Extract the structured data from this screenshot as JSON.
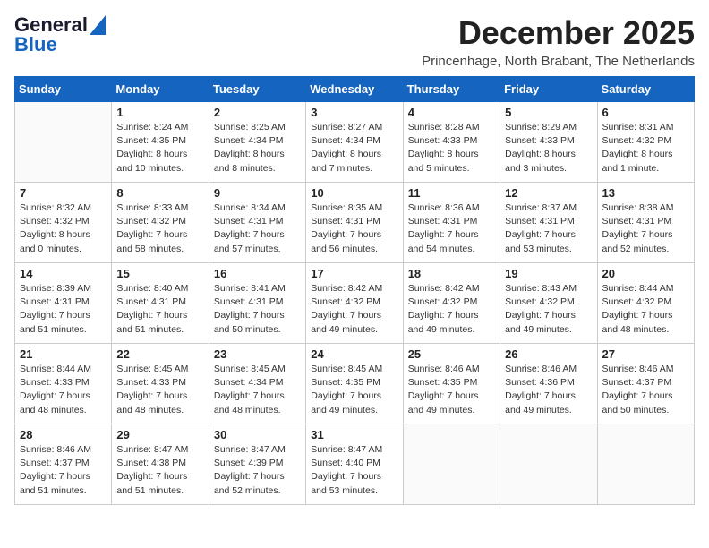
{
  "header": {
    "logo_general": "General",
    "logo_blue": "Blue",
    "month_title": "December 2025",
    "subtitle": "Princenhage, North Brabant, The Netherlands"
  },
  "weekdays": [
    "Sunday",
    "Monday",
    "Tuesday",
    "Wednesday",
    "Thursday",
    "Friday",
    "Saturday"
  ],
  "weeks": [
    [
      {
        "day": "",
        "info": ""
      },
      {
        "day": "1",
        "info": "Sunrise: 8:24 AM\nSunset: 4:35 PM\nDaylight: 8 hours\nand 10 minutes."
      },
      {
        "day": "2",
        "info": "Sunrise: 8:25 AM\nSunset: 4:34 PM\nDaylight: 8 hours\nand 8 minutes."
      },
      {
        "day": "3",
        "info": "Sunrise: 8:27 AM\nSunset: 4:34 PM\nDaylight: 8 hours\nand 7 minutes."
      },
      {
        "day": "4",
        "info": "Sunrise: 8:28 AM\nSunset: 4:33 PM\nDaylight: 8 hours\nand 5 minutes."
      },
      {
        "day": "5",
        "info": "Sunrise: 8:29 AM\nSunset: 4:33 PM\nDaylight: 8 hours\nand 3 minutes."
      },
      {
        "day": "6",
        "info": "Sunrise: 8:31 AM\nSunset: 4:32 PM\nDaylight: 8 hours\nand 1 minute."
      }
    ],
    [
      {
        "day": "7",
        "info": "Sunrise: 8:32 AM\nSunset: 4:32 PM\nDaylight: 8 hours\nand 0 minutes."
      },
      {
        "day": "8",
        "info": "Sunrise: 8:33 AM\nSunset: 4:32 PM\nDaylight: 7 hours\nand 58 minutes."
      },
      {
        "day": "9",
        "info": "Sunrise: 8:34 AM\nSunset: 4:31 PM\nDaylight: 7 hours\nand 57 minutes."
      },
      {
        "day": "10",
        "info": "Sunrise: 8:35 AM\nSunset: 4:31 PM\nDaylight: 7 hours\nand 56 minutes."
      },
      {
        "day": "11",
        "info": "Sunrise: 8:36 AM\nSunset: 4:31 PM\nDaylight: 7 hours\nand 54 minutes."
      },
      {
        "day": "12",
        "info": "Sunrise: 8:37 AM\nSunset: 4:31 PM\nDaylight: 7 hours\nand 53 minutes."
      },
      {
        "day": "13",
        "info": "Sunrise: 8:38 AM\nSunset: 4:31 PM\nDaylight: 7 hours\nand 52 minutes."
      }
    ],
    [
      {
        "day": "14",
        "info": "Sunrise: 8:39 AM\nSunset: 4:31 PM\nDaylight: 7 hours\nand 51 minutes."
      },
      {
        "day": "15",
        "info": "Sunrise: 8:40 AM\nSunset: 4:31 PM\nDaylight: 7 hours\nand 51 minutes."
      },
      {
        "day": "16",
        "info": "Sunrise: 8:41 AM\nSunset: 4:31 PM\nDaylight: 7 hours\nand 50 minutes."
      },
      {
        "day": "17",
        "info": "Sunrise: 8:42 AM\nSunset: 4:32 PM\nDaylight: 7 hours\nand 49 minutes."
      },
      {
        "day": "18",
        "info": "Sunrise: 8:42 AM\nSunset: 4:32 PM\nDaylight: 7 hours\nand 49 minutes."
      },
      {
        "day": "19",
        "info": "Sunrise: 8:43 AM\nSunset: 4:32 PM\nDaylight: 7 hours\nand 49 minutes."
      },
      {
        "day": "20",
        "info": "Sunrise: 8:44 AM\nSunset: 4:32 PM\nDaylight: 7 hours\nand 48 minutes."
      }
    ],
    [
      {
        "day": "21",
        "info": "Sunrise: 8:44 AM\nSunset: 4:33 PM\nDaylight: 7 hours\nand 48 minutes."
      },
      {
        "day": "22",
        "info": "Sunrise: 8:45 AM\nSunset: 4:33 PM\nDaylight: 7 hours\nand 48 minutes."
      },
      {
        "day": "23",
        "info": "Sunrise: 8:45 AM\nSunset: 4:34 PM\nDaylight: 7 hours\nand 48 minutes."
      },
      {
        "day": "24",
        "info": "Sunrise: 8:45 AM\nSunset: 4:35 PM\nDaylight: 7 hours\nand 49 minutes."
      },
      {
        "day": "25",
        "info": "Sunrise: 8:46 AM\nSunset: 4:35 PM\nDaylight: 7 hours\nand 49 minutes."
      },
      {
        "day": "26",
        "info": "Sunrise: 8:46 AM\nSunset: 4:36 PM\nDaylight: 7 hours\nand 49 minutes."
      },
      {
        "day": "27",
        "info": "Sunrise: 8:46 AM\nSunset: 4:37 PM\nDaylight: 7 hours\nand 50 minutes."
      }
    ],
    [
      {
        "day": "28",
        "info": "Sunrise: 8:46 AM\nSunset: 4:37 PM\nDaylight: 7 hours\nand 51 minutes."
      },
      {
        "day": "29",
        "info": "Sunrise: 8:47 AM\nSunset: 4:38 PM\nDaylight: 7 hours\nand 51 minutes."
      },
      {
        "day": "30",
        "info": "Sunrise: 8:47 AM\nSunset: 4:39 PM\nDaylight: 7 hours\nand 52 minutes."
      },
      {
        "day": "31",
        "info": "Sunrise: 8:47 AM\nSunset: 4:40 PM\nDaylight: 7 hours\nand 53 minutes."
      },
      {
        "day": "",
        "info": ""
      },
      {
        "day": "",
        "info": ""
      },
      {
        "day": "",
        "info": ""
      }
    ]
  ]
}
